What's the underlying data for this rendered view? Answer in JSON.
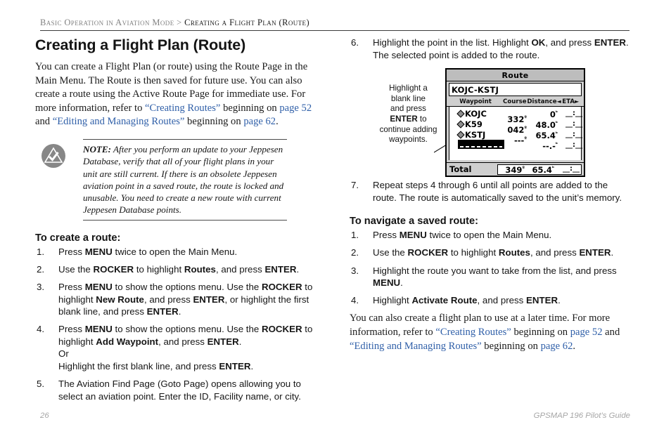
{
  "breadcrumb": {
    "parent": "Basic Operation in Aviation Mode",
    "separator": ">",
    "current": "Creating a Flight Plan (Route)"
  },
  "page_title": "Creating a Flight Plan (Route)",
  "intro": {
    "t1": "You can create a Flight Plan (or route) using the Route Page in the Main Menu. The Route is then saved for future use. You can also create a route using the Active Route Page for immediate use. For more information, refer to ",
    "link1": "“Creating Routes”",
    "t2": " beginning on ",
    "link2": "page 52",
    "t3": " and ",
    "link3": "“Editing and Managing Routes”",
    "t4": " beginning on ",
    "link4": "page 62",
    "t5": "."
  },
  "note": {
    "label": "NOTE:",
    "icon": "warning-triangle-icon",
    "text": " After you perform an update to your Jeppesen Database, verify that all of your flight plans in your unit are still current. If there is an obsolete Jeppesen aviation point in a saved route, the route is locked and unusable. You need to create a new route with current Jeppesen Database points."
  },
  "create_route": {
    "heading": "To create a route:",
    "steps": [
      {
        "num": "1.",
        "parts": [
          {
            "t": "Press "
          },
          {
            "b": "MENU"
          },
          {
            "t": " twice to open the Main Menu."
          }
        ]
      },
      {
        "num": "2.",
        "parts": [
          {
            "t": "Use the "
          },
          {
            "b": "ROCKER"
          },
          {
            "t": " to highlight "
          },
          {
            "b": "Routes"
          },
          {
            "t": ", and press "
          },
          {
            "b": "ENTER"
          },
          {
            "t": "."
          }
        ]
      },
      {
        "num": "3.",
        "parts": [
          {
            "t": "Press "
          },
          {
            "b": "MENU"
          },
          {
            "t": " to show the options menu. Use the "
          },
          {
            "b": "ROCKER"
          },
          {
            "t": " to highlight "
          },
          {
            "b": "New Route"
          },
          {
            "t": ", and press "
          },
          {
            "b": "ENTER"
          },
          {
            "t": ", or highlight the first blank line, and press "
          },
          {
            "b": "ENTER"
          },
          {
            "t": "."
          }
        ]
      },
      {
        "num": "4.",
        "parts": [
          {
            "t": "Press "
          },
          {
            "b": "MENU"
          },
          {
            "t": " to show the options menu. Use the "
          },
          {
            "b": "ROCKER"
          },
          {
            "t": " to highlight "
          },
          {
            "b": "Add Waypoint"
          },
          {
            "t": ", and press "
          },
          {
            "b": "ENTER"
          },
          {
            "t": "."
          },
          {
            "br": true
          },
          {
            "t": "Or"
          },
          {
            "br": true
          },
          {
            "t": "Highlight the first blank line, and press "
          },
          {
            "b": "ENTER"
          },
          {
            "t": "."
          }
        ]
      },
      {
        "num": "5.",
        "parts": [
          {
            "t": "The Aviation Find Page (Goto Page) opens allowing you to select an aviation point. Enter the ID, Facility name, or city."
          }
        ]
      }
    ]
  },
  "right_steps": {
    "step6": {
      "num": "6.",
      "parts": [
        {
          "t": "Highlight the point in the list. Highlight "
        },
        {
          "b": "OK"
        },
        {
          "t": ", and press "
        },
        {
          "b": "ENTER"
        },
        {
          "t": ". The selected point is added to the route."
        }
      ]
    },
    "step7": {
      "num": "7.",
      "parts": [
        {
          "t": "Repeat steps 4 through 6 until all points are added to the route. The route is automatically saved to the unit’s memory."
        }
      ]
    }
  },
  "callout": {
    "l1": "Highlight a",
    "l2": "blank line",
    "l3": "and press",
    "key": "ENTER",
    "l4": " to",
    "l5": "continue adding",
    "l6": "waypoints."
  },
  "device": {
    "title": "Route",
    "route_name": "KOJC-KSTJ",
    "columns": {
      "waypoint": "Waypoint",
      "course": "Course",
      "distance": "Distance",
      "eta": "ETA",
      "arrow_left": "◄",
      "arrow_right": "►"
    },
    "rows": [
      {
        "name": "KOJC",
        "course": "332",
        "course_unit": "º",
        "distance": "0",
        "distance_unit": "ᵇ",
        "eta": "__:__"
      },
      {
        "name": "K59",
        "course": "042",
        "course_unit": "º",
        "distance": "48.0",
        "distance_unit": "ᵇ",
        "eta": "__:__"
      },
      {
        "name": "KSTJ",
        "course": "---",
        "course_unit": "º",
        "distance": "65.4",
        "distance_unit": "ᵇ",
        "eta": "__:__"
      },
      {
        "name": "",
        "course": "",
        "course_unit": "",
        "distance": "--.-",
        "distance_unit": "ᵇ",
        "eta": "__:__"
      }
    ],
    "total": {
      "label": "Total",
      "course": "349",
      "course_unit": "º",
      "distance": "65.4",
      "distance_unit": "ᵇ",
      "eta": "__:__"
    }
  },
  "navigate_route": {
    "heading": "To navigate a saved route:",
    "steps": [
      {
        "num": "1.",
        "parts": [
          {
            "t": "Press "
          },
          {
            "b": "MENU"
          },
          {
            "t": " twice to open the Main Menu."
          }
        ]
      },
      {
        "num": "2.",
        "parts": [
          {
            "t": "Use the "
          },
          {
            "b": "ROCKER"
          },
          {
            "t": " to highlight "
          },
          {
            "b": "Routes"
          },
          {
            "t": ", and press "
          },
          {
            "b": "ENTER"
          },
          {
            "t": "."
          }
        ]
      },
      {
        "num": "3.",
        "parts": [
          {
            "t": "Highlight the route you want to take from the list, and press "
          },
          {
            "b": "MENU"
          },
          {
            "t": "."
          }
        ]
      },
      {
        "num": "4.",
        "parts": [
          {
            "t": "Highlight "
          },
          {
            "b": "Activate Route"
          },
          {
            "t": ", and press "
          },
          {
            "b": "ENTER"
          },
          {
            "t": "."
          }
        ]
      }
    ]
  },
  "outro": {
    "t1": "You can also create a flight plan to use at a later time. For more information, refer to ",
    "link1": "“Creating Routes”",
    "t2": " beginning on ",
    "link2": "page 52",
    "t3": " and ",
    "link3": "“Editing and Managing Routes”",
    "t4": " beginning on ",
    "link4": "page 62",
    "t5": "."
  },
  "footer": {
    "page_number": "26",
    "guide_title": "GPSMAP 196 Pilot’s Guide"
  },
  "colors": {
    "link": "#2f5fa8",
    "breadcrumb_parent": "#808080",
    "footer": "#a6a6a6",
    "device_bg": "#cfcfcf"
  }
}
